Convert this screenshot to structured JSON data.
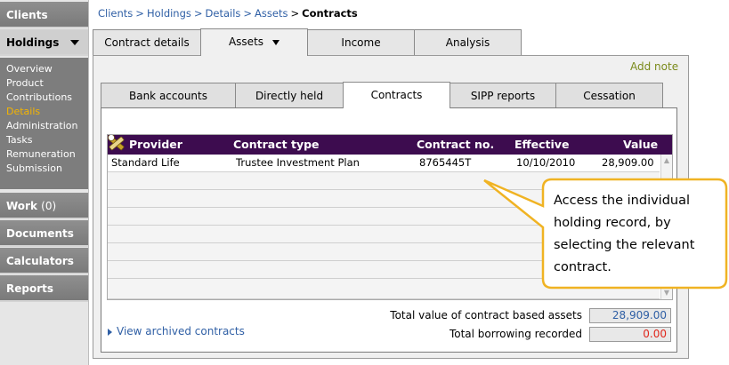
{
  "sidebar": {
    "clients": "Clients",
    "holdings": "Holdings",
    "submenu": [
      "Overview",
      "Product",
      "Contributions",
      "Details",
      "Administration",
      "Tasks",
      "Remuneration",
      "Submission"
    ],
    "active_submenu": "Details",
    "work": "Work",
    "work_count": "(0)",
    "documents": "Documents",
    "calculators": "Calculators",
    "reports": "Reports"
  },
  "breadcrumb": {
    "items": [
      "Clients",
      "Holdings",
      "Details",
      "Assets"
    ],
    "separator": ">",
    "current": "Contracts"
  },
  "top_tabs": [
    "Contract details",
    "Assets",
    "Income",
    "Analysis"
  ],
  "active_top_tab": "Assets",
  "add_note": "Add note",
  "sub_tabs": [
    "Bank accounts",
    "Directly held",
    "Contracts",
    "SIPP reports",
    "Cessation"
  ],
  "active_sub_tab": "Contracts",
  "table": {
    "headers": [
      "Provider",
      "Contract type",
      "Contract no.",
      "Effective",
      "Value"
    ],
    "rows": [
      [
        "Standard Life",
        "Trustee Investment Plan",
        "8765445T",
        "10/10/2010",
        "28,909.00"
      ]
    ]
  },
  "totals": {
    "contract_assets_label": "Total value of contract based assets",
    "contract_assets_value": "28,909.00",
    "borrowing_label": "Total borrowing recorded",
    "borrowing_value": "0.00"
  },
  "archived_link": "View archived contracts",
  "callout": {
    "lines": [
      "Access the individual",
      "holding record, by",
      "selecting the relevant",
      "contract."
    ]
  },
  "colors": {
    "header_bg": "#3d0c4f",
    "callout_border": "#f0b323",
    "link": "#2f5fa5",
    "active_submenu": "#f4b400",
    "borrowing_value": "#e0261b"
  }
}
